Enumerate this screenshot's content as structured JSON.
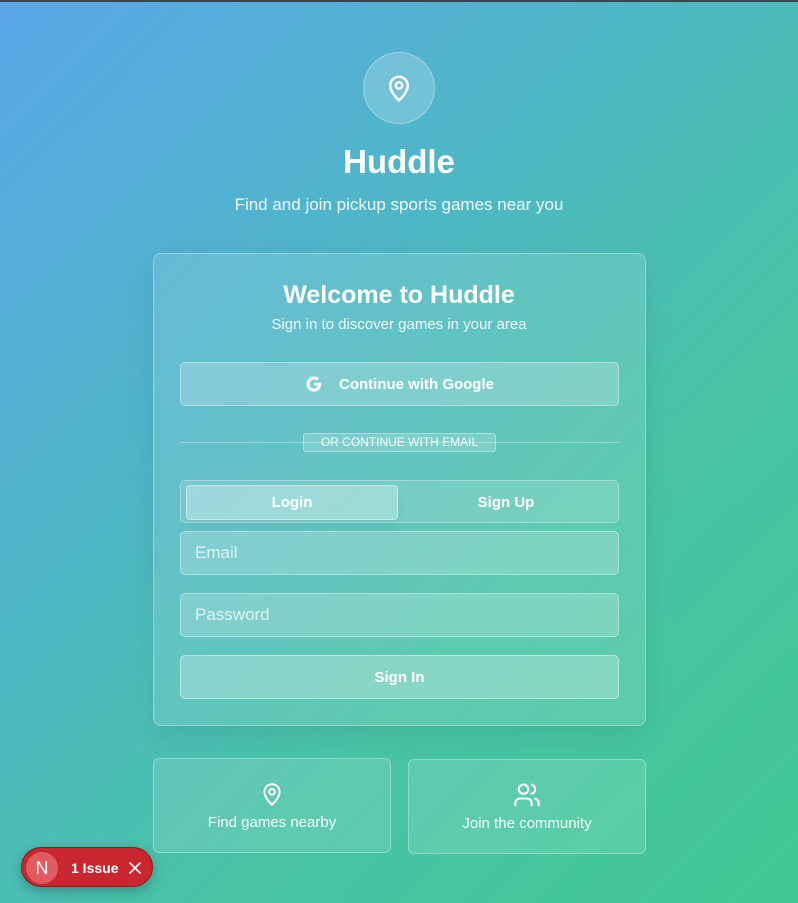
{
  "app": {
    "title": "Huddle",
    "subtitle": "Find and join pickup sports games near you",
    "logo_icon": "map-pin-icon"
  },
  "card": {
    "title": "Welcome to Huddle",
    "subtitle": "Sign in to discover games in your area",
    "google_button": {
      "label": "Continue with Google",
      "icon": "google-icon"
    },
    "divider_text": "OR CONTINUE WITH EMAIL",
    "tabs": [
      {
        "label": "Login",
        "active": true
      },
      {
        "label": "Sign Up",
        "active": false
      }
    ],
    "email": {
      "placeholder": "Email",
      "value": ""
    },
    "password": {
      "placeholder": "Password",
      "value": ""
    },
    "submit_label": "Sign In"
  },
  "features": [
    {
      "label": "Find games nearby",
      "icon": "map-pin-icon"
    },
    {
      "label": "Join the community",
      "icon": "users-icon"
    }
  ],
  "issues_badge": {
    "avatar_letter": "N",
    "label": "1 Issue",
    "color": "#c9262f"
  },
  "colors": {
    "gradient_start": "#5aa6e8",
    "gradient_end": "#42c894"
  }
}
